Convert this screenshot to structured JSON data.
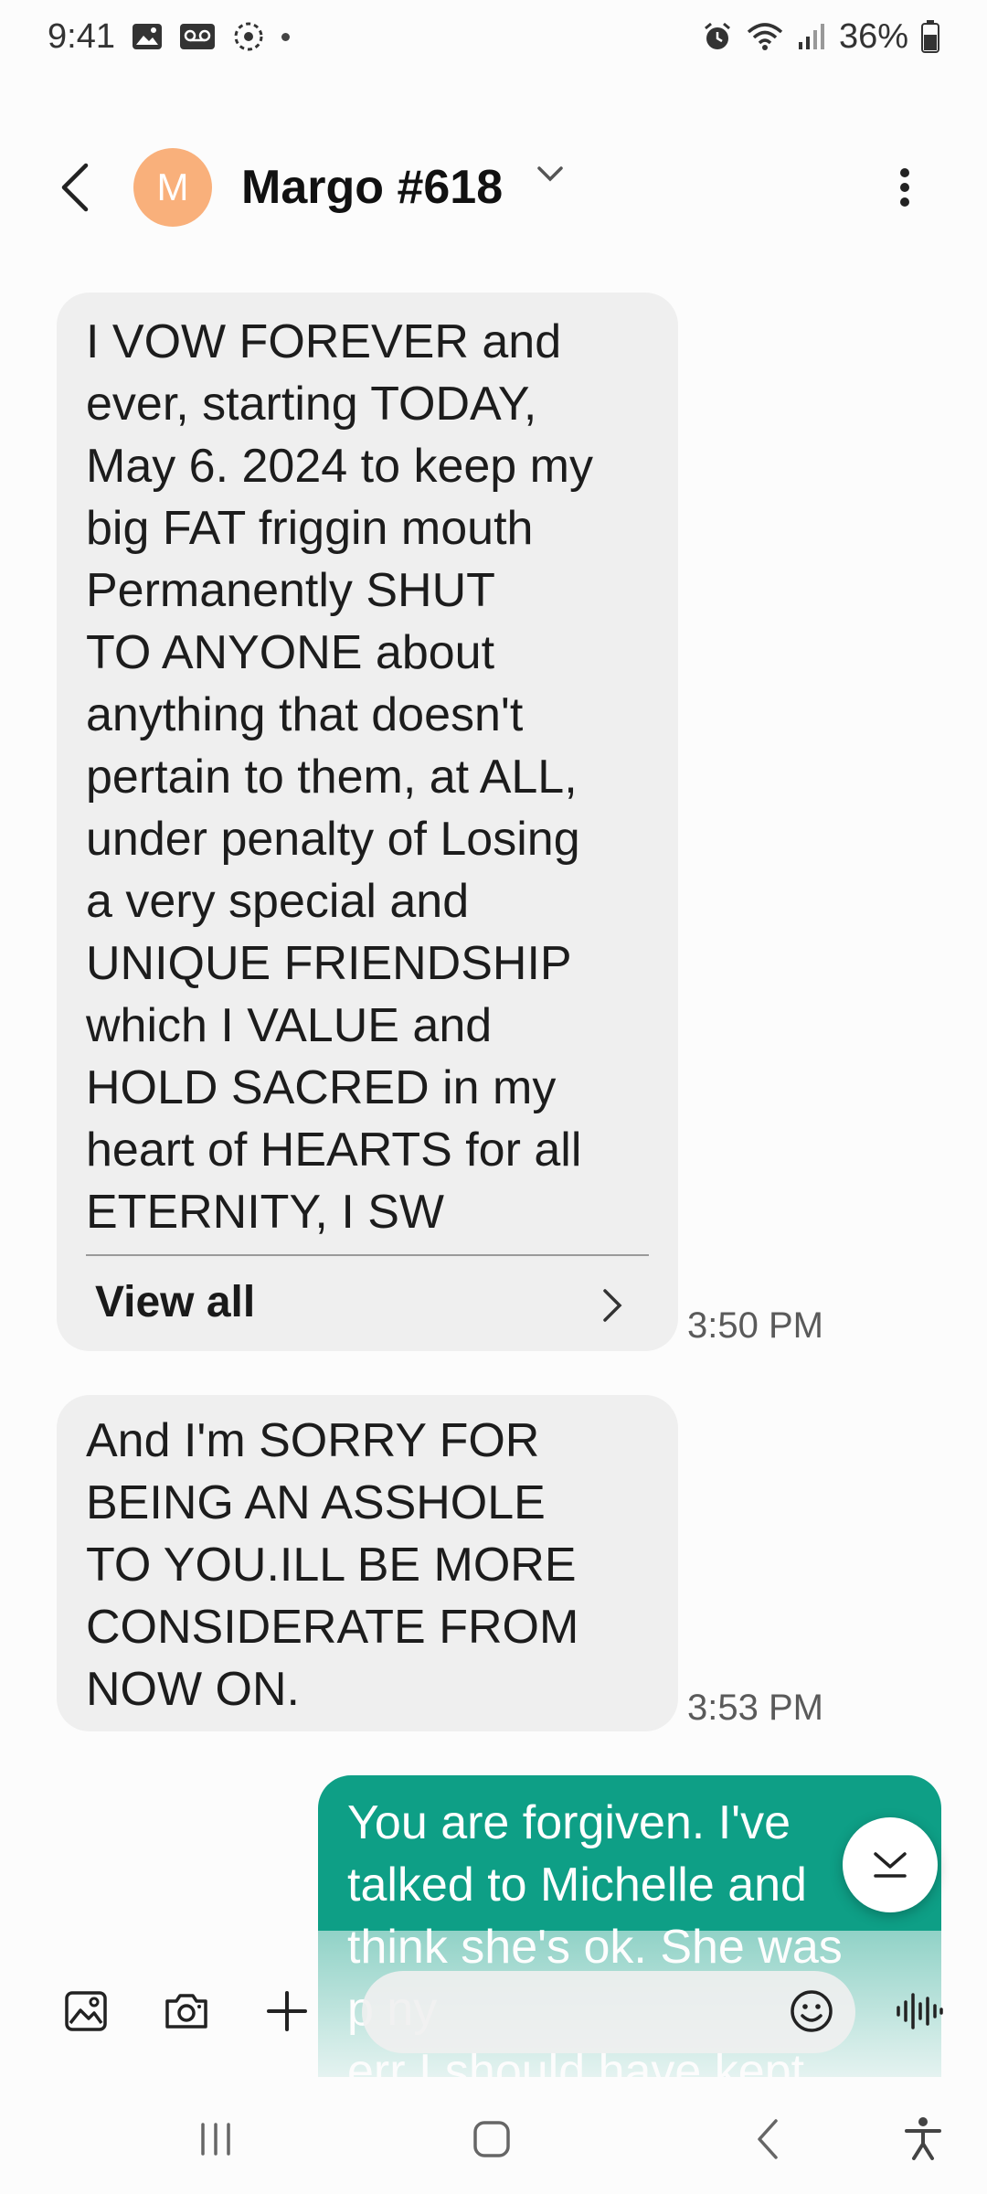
{
  "status_bar": {
    "time": "9:41",
    "battery": "36%",
    "left_icons": [
      "gallery-icon",
      "voicemail-icon",
      "sync-icon",
      "dot-icon"
    ],
    "right_icons": [
      "alarm-icon",
      "wifi-icon",
      "signal-icon",
      "battery-icon"
    ]
  },
  "header": {
    "avatar_letter": "M",
    "contact_name": "Margo #618",
    "avatar_color": "#f9b07b"
  },
  "messages": [
    {
      "direction": "received",
      "text": "I VOW FOREVER and\never, starting TODAY,\nMay 6. 2024 to keep my\nbig FAT friggin mouth\nPermanently SHUT\nTO ANYONE about\nanything that doesn't\npertain to them, at ALL,\nunder penalty of Losing\na very special and\nUNIQUE FRIENDSHIP\nwhich I VALUE and\nHOLD SACRED in my\nheart of HEARTS for all\nETERNITY, I SW",
      "view_all_label": "View all",
      "time": "3:50 PM"
    },
    {
      "direction": "received",
      "text": "And I'm SORRY FOR\nBEING AN ASSHOLE\nTO YOU.ILL BE MORE\nCONSIDERATE FROM\nNOW ON.",
      "time": "3:53 PM"
    },
    {
      "direction": "sent",
      "text": "You are forgiven. I've\ntalked to Michelle and\nthink she's ok. She was\np                          ny\nerr     I should have kept"
    }
  ],
  "composer": {
    "placeholder": "",
    "icons": [
      "gallery-icon",
      "camera-icon",
      "add-icon",
      "emoji-icon",
      "voice-icon"
    ]
  },
  "colors": {
    "sent_bubble": "#0e9f86",
    "received_bubble": "#efefef",
    "background": "#fcfcfc"
  }
}
